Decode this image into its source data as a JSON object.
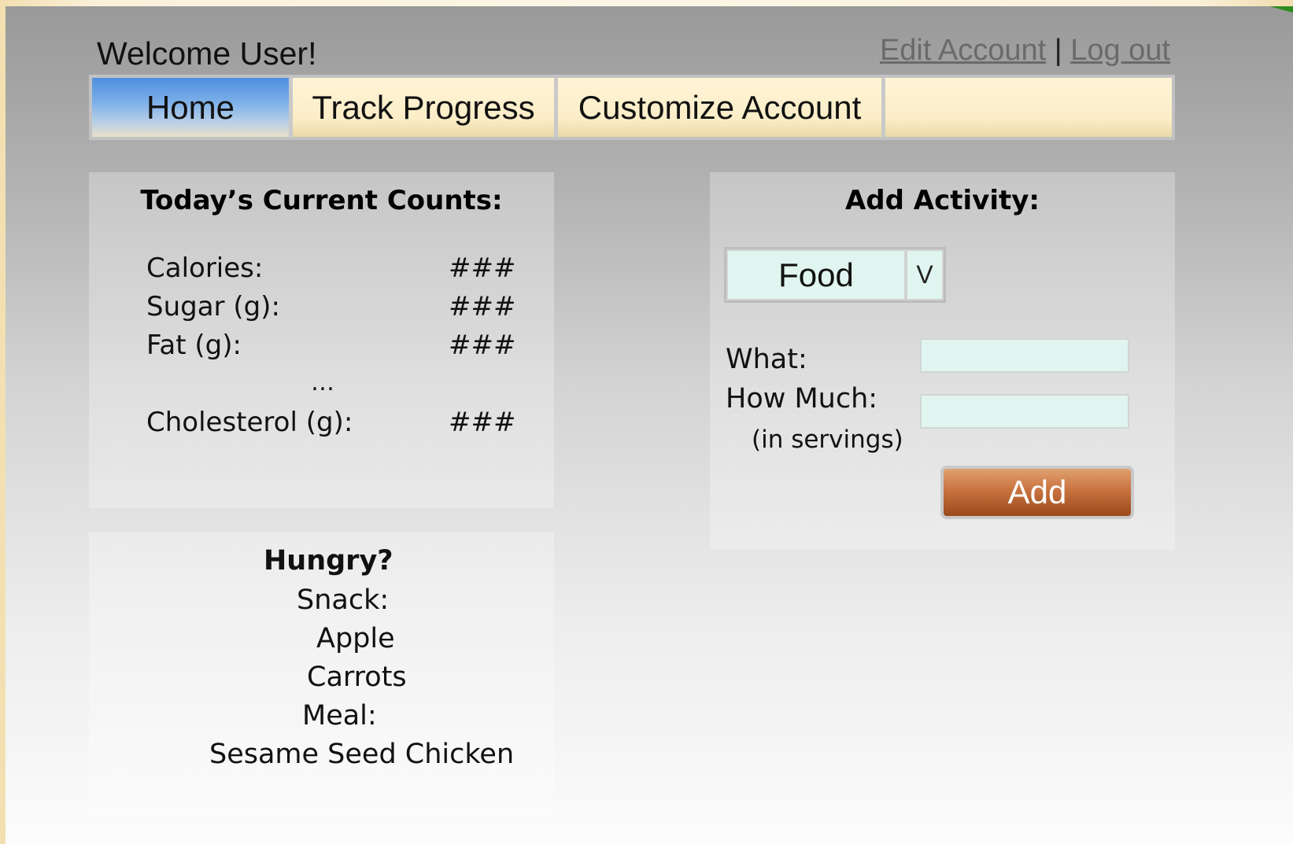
{
  "header": {
    "welcome": "Welcome User!",
    "edit_account": "Edit Account",
    "separator": "|",
    "log_out": "Log out"
  },
  "nav": {
    "tabs": [
      {
        "label": "Home",
        "active": true
      },
      {
        "label": "Track Progress",
        "active": false
      },
      {
        "label": "Customize Account",
        "active": false
      },
      {
        "label": "",
        "active": false
      }
    ]
  },
  "counts": {
    "title": "Today’s Current Counts:",
    "rows": [
      {
        "label": "Calories:",
        "value": "###"
      },
      {
        "label": "Sugar (g):",
        "value": "###"
      },
      {
        "label": "Fat (g):",
        "value": "###"
      },
      {
        "label": "Cholesterol (g):",
        "value": "###"
      }
    ],
    "ellipsis": "…"
  },
  "hungry": {
    "title": "Hungry?",
    "snack_label": "Snack:",
    "snacks": [
      "Apple",
      "Carrots"
    ],
    "meal_label": "Meal:",
    "meals": [
      "Sesame Seed Chicken"
    ]
  },
  "activity": {
    "title": "Add Activity:",
    "type_select": {
      "value": "Food",
      "arrow": "V"
    },
    "what_label": "What:",
    "what_value": "",
    "how_much_label": "How Much:",
    "how_much_value": "",
    "servings_note": "(in servings)",
    "add_button": "Add"
  },
  "colors": {
    "active_tab": "#4f8fe0",
    "tab_background": "#fbedc7",
    "input_background": "#e0f5f0",
    "add_button": "#c9733f"
  }
}
